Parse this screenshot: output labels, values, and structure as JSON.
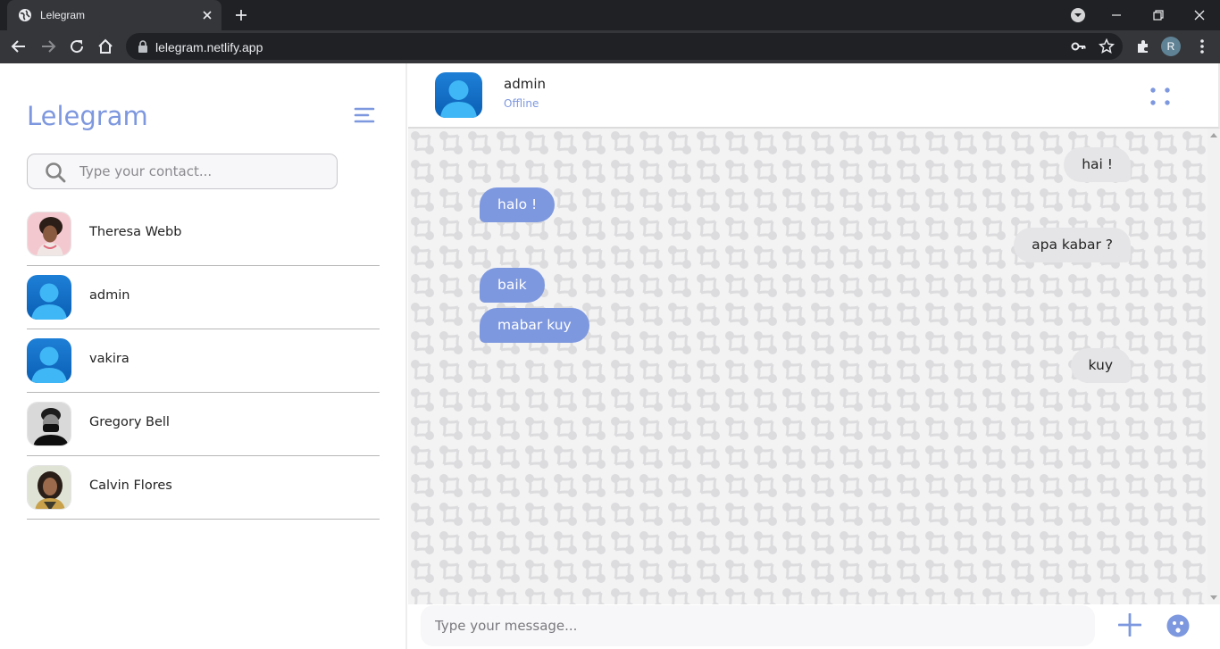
{
  "browser": {
    "tab_title": "Lelegram",
    "url": "lelegram.netlify.app",
    "profile_initial": "R"
  },
  "sidebar": {
    "brand": "Lelegram",
    "search_placeholder": "Type your contact...",
    "contacts": [
      {
        "name": "Theresa Webb"
      },
      {
        "name": "admin"
      },
      {
        "name": "vakira"
      },
      {
        "name": "Gregory Bell"
      },
      {
        "name": "Calvin Flores"
      }
    ]
  },
  "chat": {
    "name": "admin",
    "status": "Offline",
    "messages": [
      {
        "from": "me",
        "text": "hai !"
      },
      {
        "from": "them",
        "text": "halo !"
      },
      {
        "from": "me",
        "text": "apa kabar ?"
      },
      {
        "from": "them",
        "text": "baik"
      },
      {
        "from": "them",
        "text": "mabar kuy"
      },
      {
        "from": "me",
        "text": "kuy"
      }
    ],
    "input_placeholder": "Type your message..."
  },
  "colors": {
    "accent": "#7e98df",
    "bubble_mine": "#e5e5e7",
    "pattern": "#dcdcde"
  },
  "icons": [
    "menu-icon",
    "search-icon",
    "dots-icon",
    "plus-icon",
    "emoji-icon"
  ]
}
